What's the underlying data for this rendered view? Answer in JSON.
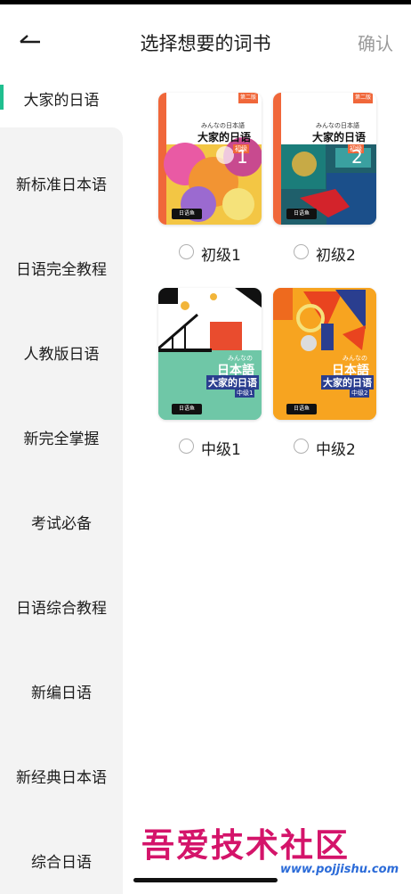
{
  "header": {
    "title": "选择想要的词书",
    "confirm_label": "确认"
  },
  "sidebar": {
    "items": [
      {
        "label": "大家的日语",
        "active": true
      },
      {
        "label": "新标准日本语"
      },
      {
        "label": "日语完全教程"
      },
      {
        "label": "人教版日语"
      },
      {
        "label": "新完全掌握"
      },
      {
        "label": "考试必备"
      },
      {
        "label": "日语综合教程"
      },
      {
        "label": "新编日语"
      },
      {
        "label": "新经典日本语"
      },
      {
        "label": "综合日语"
      }
    ]
  },
  "books": [
    {
      "label": "初级1",
      "cover_sub": "みんなの日本語",
      "cover_title": "大家的日语",
      "cover_level": "初级",
      "cover_num": "1",
      "edition": "第二版",
      "logo": "日语鱼"
    },
    {
      "label": "初级2",
      "cover_sub": "みんなの日本語",
      "cover_title": "大家的日语",
      "cover_level": "初级",
      "cover_num": "2",
      "edition": "第二版",
      "logo": "日语鱼"
    },
    {
      "label": "中级1",
      "cover_sub": "みんなの",
      "cover_main": "日本語",
      "cover_title": "大家的日语",
      "cover_level": "中级1",
      "logo": "日语鱼"
    },
    {
      "label": "中级2",
      "cover_sub": "みんなの",
      "cover_main": "日本語",
      "cover_title": "大家的日语",
      "cover_level": "中级2",
      "logo": "日语鱼"
    }
  ],
  "watermark": {
    "title": "吾爱技术社区",
    "url": "www.pojjishu.com"
  },
  "colors": {
    "accent": "#1fbf8f",
    "confirm": "#9a9a9a",
    "sidebar_bg": "#f3f3f3",
    "watermark": "#d4146a",
    "url": "#2b6bd8"
  }
}
